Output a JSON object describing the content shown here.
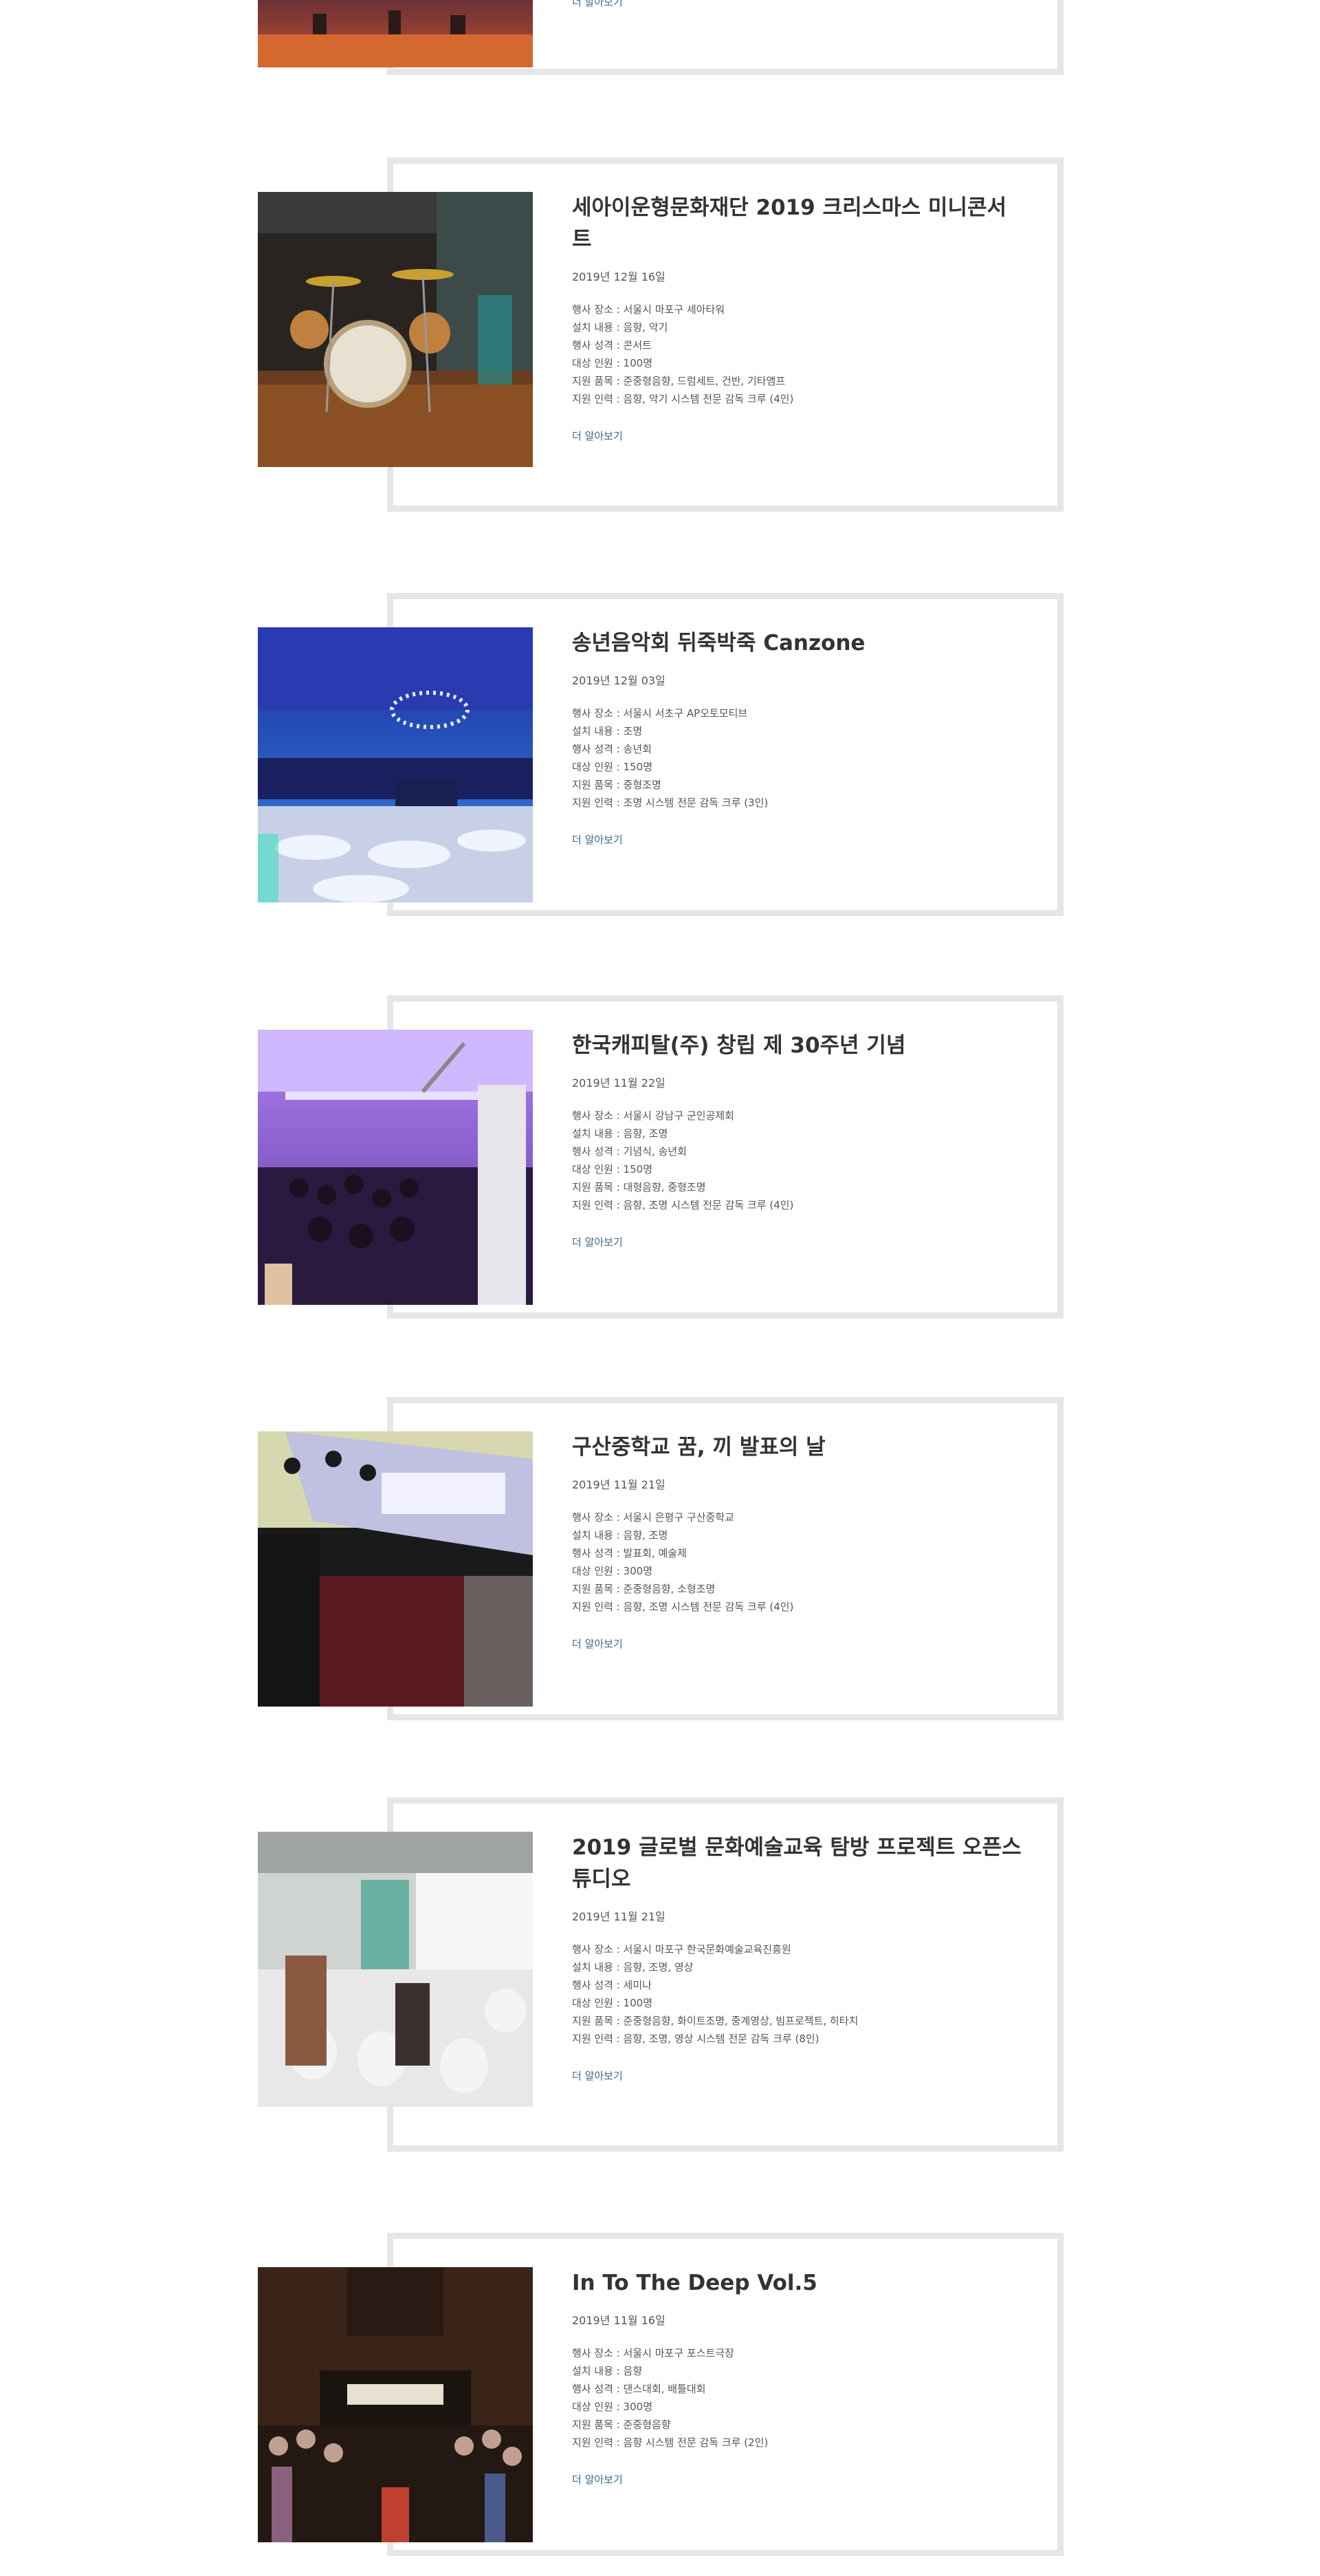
{
  "more_label": "더 알아보기",
  "posts": [
    {
      "title": "세아이운형문화재단 2019 크리스마스 미니콘서트",
      "date": "2019년 12월 16일",
      "details": [
        "행사 장소 : 서울시 마포구 세아타워",
        "설치 내용 : 음향, 악기",
        "행사 성격 : 콘서트",
        "대상 인원 : 100명",
        "지원 품목 : 준중형음향, 드럼세트, 건반, 기타앰프",
        "지원 인력 : 음향, 악기 시스템 전문 감독 크루 (4인)"
      ]
    },
    {
      "title": "송년음악회 뒤죽박죽 Canzone",
      "date": "2019년 12월 03일",
      "details": [
        "행사 장소 : 서울시 서초구 AP오토모티브",
        "설치 내용 : 조명",
        "행사 성격 : 송년회",
        "대상 인원 : 150명",
        "지원 품목 : 중형조명",
        "지원 인력 : 조명 시스템 전문 감독 크루 (3인)"
      ]
    },
    {
      "title": "한국캐피탈(주) 창립 제 30주년 기념",
      "date": "2019년 11월 22일",
      "details": [
        "행사 장소 : 서울시 강남구 군인공제회",
        "설치 내용 : 음향, 조명",
        "행사 성격 : 기념식, 송년회",
        "대상 인원 : 150명",
        "지원 품목 : 대형음향, 중형조명",
        "지원 인력 : 음향, 조명 시스템 전문 감독 크루 (4인)"
      ]
    },
    {
      "title": "구산중학교 꿈, 끼 발표의 날",
      "date": "2019년 11월 21일",
      "details": [
        "행사 장소 : 서울시 은평구 구산중학교",
        "설치 내용 : 음향, 조명",
        "행사 성격 : 발표회, 예술제",
        "대상 인원 : 300명",
        "지원 품목 : 준중형음향, 소형조명",
        "지원 인력 : 음향, 조명 시스템 전문 감독 크루 (4인)"
      ]
    },
    {
      "title": "2019 글로벌 문화예술교육 탐방 프로젝트 오픈스튜디오",
      "date": "2019년 11월 21일",
      "details": [
        "행사 장소 : 서울시 마포구 한국문화예술교육진흥원",
        "설치 내용 : 음향, 조명, 영상",
        "행사 성격 : 세미나",
        "대상 인원 : 100명",
        "지원 품목 : 준중형음향, 화이트조명, 중계영상, 빔프로젝트, 히타치",
        "지원 인력 : 음향, 조명, 영상 시스템 전문 감독 크루 (8인)"
      ]
    },
    {
      "title": "In To The Deep Vol.5",
      "date": "2019년 11월 16일",
      "details": [
        "행사 장소 : 서울시 마포구 포스트극장",
        "설치 내용 : 음향",
        "행사 성격 : 댄스대회, 배틀대회",
        "대상 인원 : 300명",
        "지원 품목 : 준중형음향",
        "지원 인력 : 음향 시스템 전문 감독 크루 (2인)"
      ]
    }
  ]
}
